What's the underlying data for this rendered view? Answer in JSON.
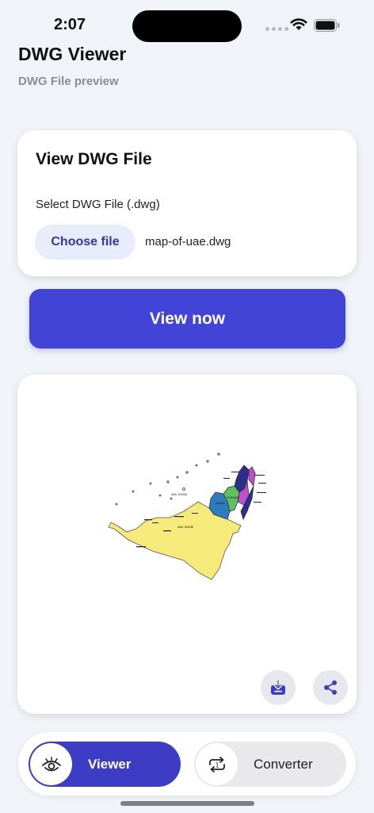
{
  "status_bar": {
    "time": "2:07"
  },
  "header": {
    "title": "DWG Viewer",
    "subtitle": "DWG File preview"
  },
  "upload": {
    "title": "View DWG File",
    "field_label": "Select DWG File (.dwg)",
    "choose_label": "Choose file",
    "file_name": "map-of-uae.dwg"
  },
  "view_button": {
    "label": "View now"
  },
  "preview": {
    "map_labels": [
      "ABU DHABI",
      "ABU DHABI",
      "DUBAI",
      "SHARJAH"
    ],
    "map_colors": {
      "abu_dhabi": "#f5ea7a",
      "dubai": "#2e7bbf",
      "sharjah": "#5fc060",
      "ajman": "#c04fcf",
      "fujairah": "#2c2e8c"
    },
    "download_icon": "download-icon",
    "share_icon": "share-icon"
  },
  "nav": {
    "viewer_label": "Viewer",
    "converter_label": "Converter",
    "converter_badge": "1",
    "active": "viewer"
  }
}
